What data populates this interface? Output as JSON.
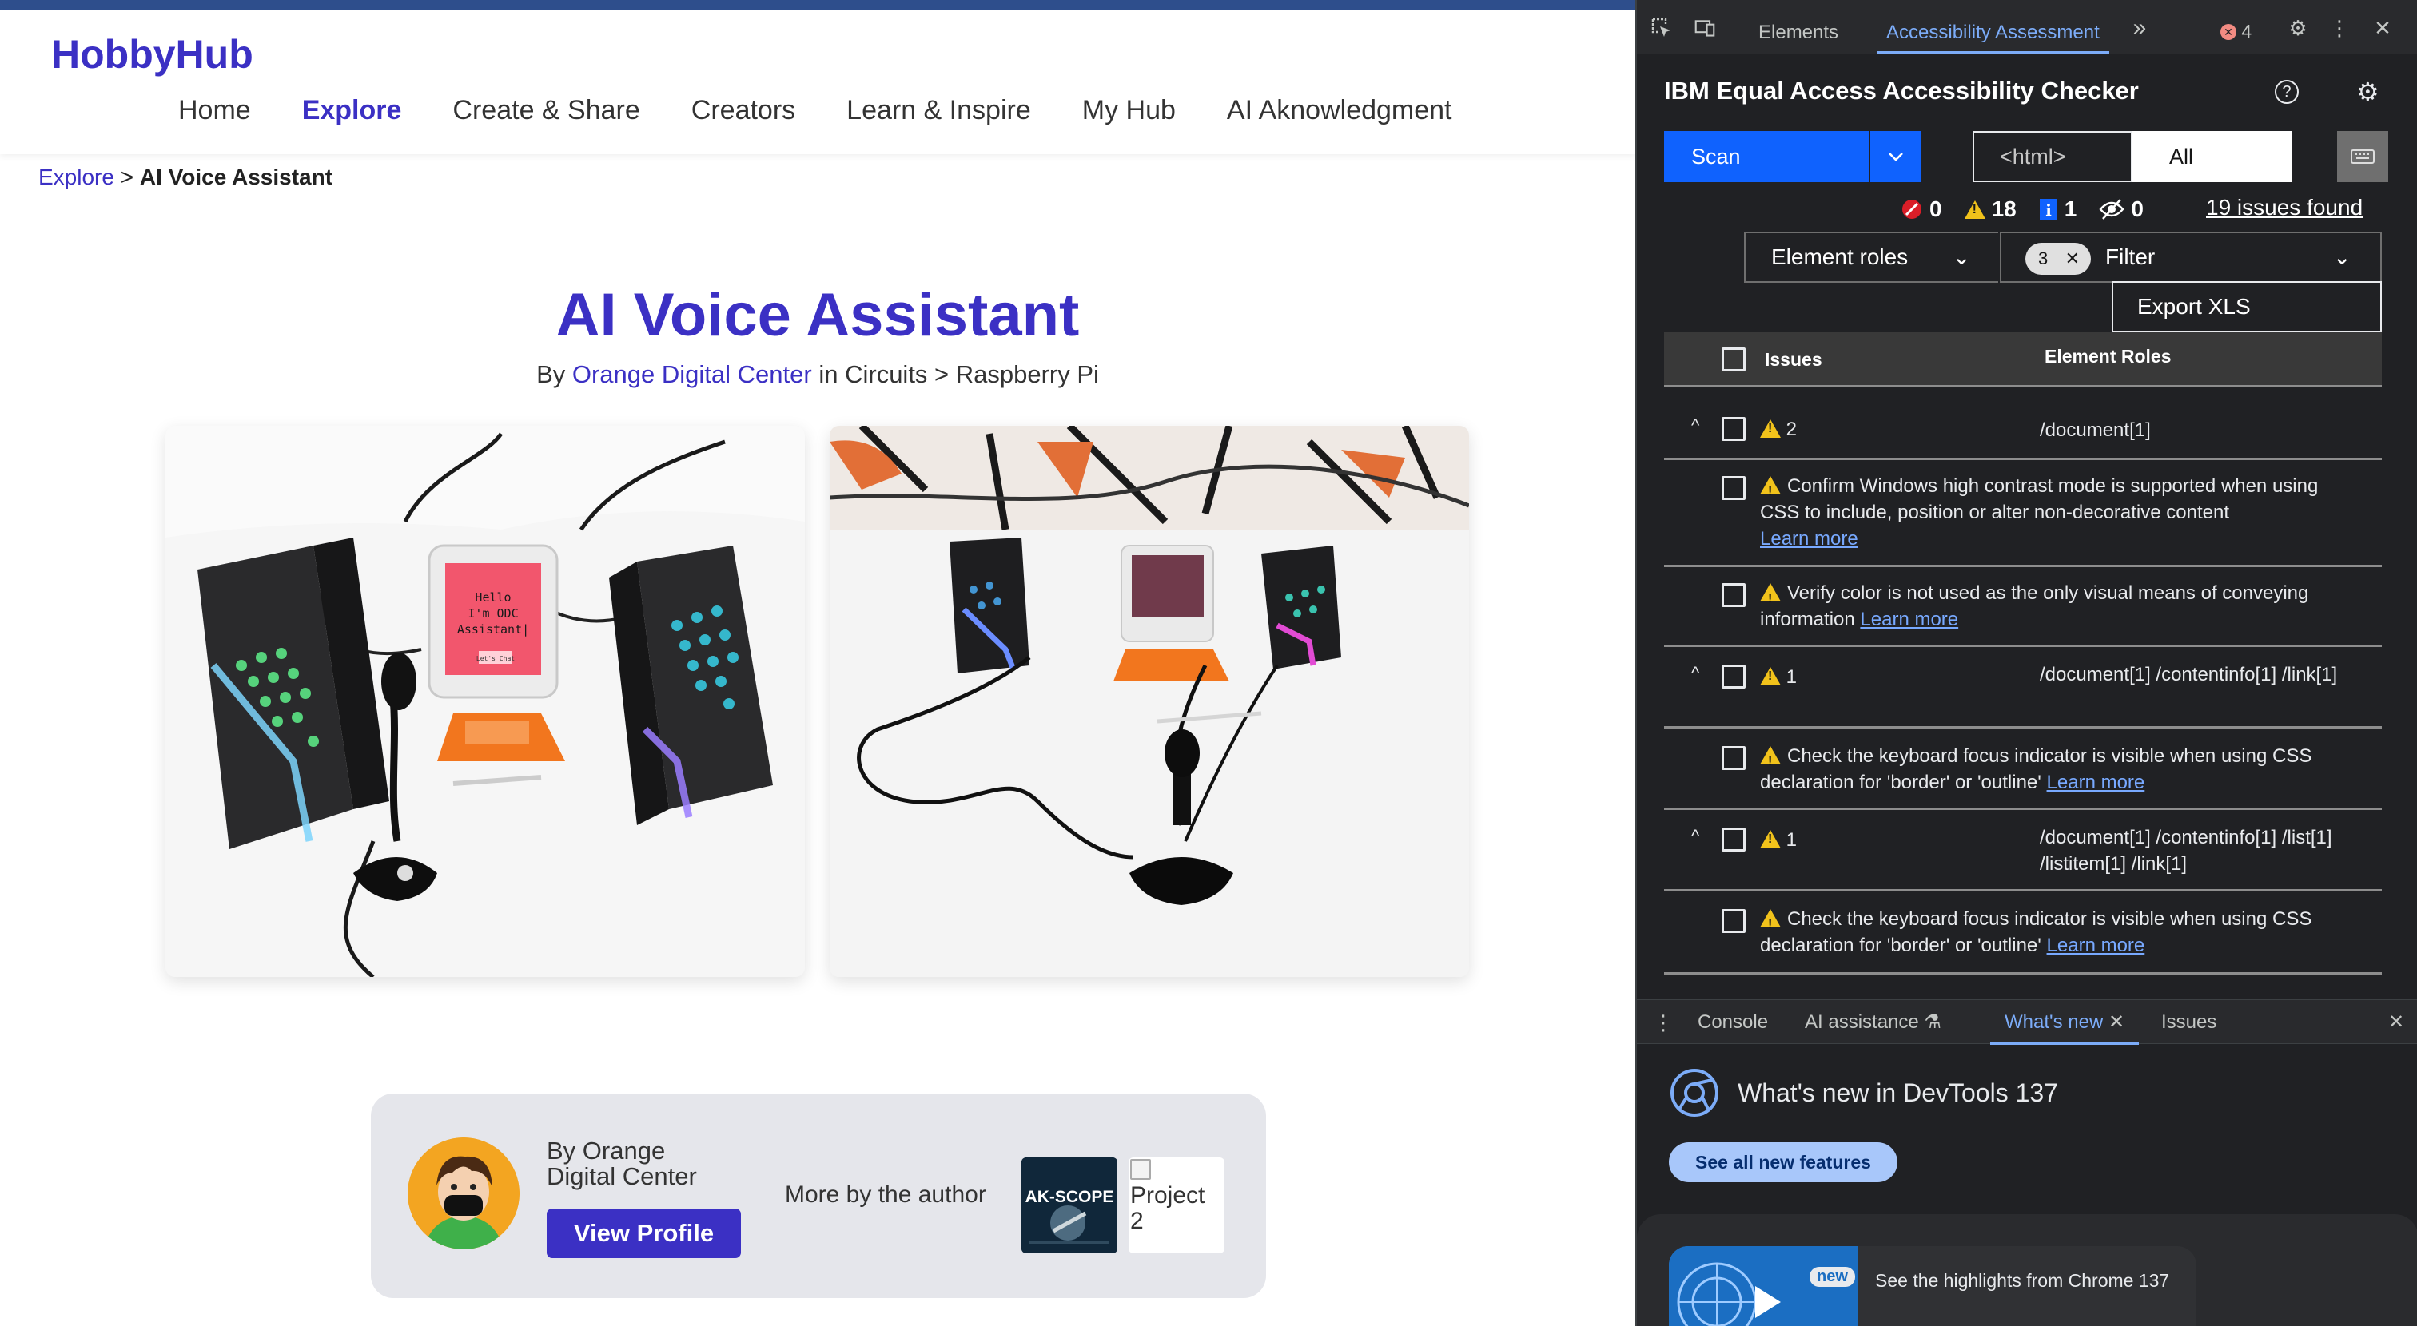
{
  "site": {
    "logo": "HobbyHub",
    "nav": [
      "Home",
      "Explore",
      "Create & Share",
      "Creators",
      "Learn & Inspire",
      "My Hub",
      "AI Aknowledgment"
    ],
    "active_nav": "Explore"
  },
  "breadcrumb": {
    "parent": "Explore",
    "separator": ">",
    "current": "AI Voice Assistant"
  },
  "project": {
    "title": "AI Voice Assistant",
    "by_prefix": "By",
    "author": "Orange Digital Center",
    "in_text": "in",
    "category_path": "Circuits > Raspberry Pi",
    "screen_text": [
      "Hello",
      "I'm ODC",
      "Assistant|",
      "Let's Chat"
    ]
  },
  "author_card": {
    "by_text": "By Orange Digital Center",
    "view_profile": "View Profile",
    "more_by": "More by the author",
    "thumb1_text": "AK-SCOPE",
    "thumb2_alt": "Project 2"
  },
  "devtools": {
    "tabs": [
      "Elements",
      "Accessibility Assessment"
    ],
    "active_tab": "Accessibility Assessment",
    "more_tabs_glyph": "»",
    "error_count": "4",
    "checker_title": "IBM Equal Access Accessibility Checker",
    "scan_label": "Scan",
    "scope_select": "<html>",
    "rule_select": "All",
    "counts": {
      "violations": "0",
      "warnings": "18",
      "info": "1",
      "hidden": "0"
    },
    "issues_found": "19 issues found",
    "group_by": "Element roles",
    "filter_tag_count": "3",
    "filter_placeholder": "Filter",
    "export_label": "Export XLS",
    "table_headers": {
      "issues": "Issues",
      "roles": "Element Roles"
    },
    "learn_more": "Learn more",
    "groups": [
      {
        "count": "2",
        "role": "/document[1]",
        "items": [
          "Confirm Windows high contrast mode is supported when using CSS to include, position or alter non-decorative content",
          "Verify color is not used as the only visual means of conveying information"
        ]
      },
      {
        "count": "1",
        "role": "/document[1] /contentinfo[1] /link[1]",
        "items": [
          "Check the keyboard focus indicator is visible when using CSS declaration for 'border' or 'outline'"
        ]
      },
      {
        "count": "1",
        "role": "/document[1] /contentinfo[1] /list[1] /listitem[1] /link[1]",
        "items": [
          "Check the keyboard focus indicator is visible when using CSS declaration for 'border' or 'outline'"
        ]
      }
    ],
    "drawer_tabs": [
      "Console",
      "AI assistance",
      "What's new",
      "Issues"
    ],
    "active_drawer": "What's new",
    "whats_new_title": "What's new in DevTools 137",
    "see_all": "See all new features",
    "new_badge": "new",
    "highlights": "See the highlights from Chrome 137"
  },
  "colors": {
    "brand": "#3b30c4",
    "scan": "#0f62fe",
    "warning": "#f1c21b",
    "devtools_bg": "#202124"
  }
}
